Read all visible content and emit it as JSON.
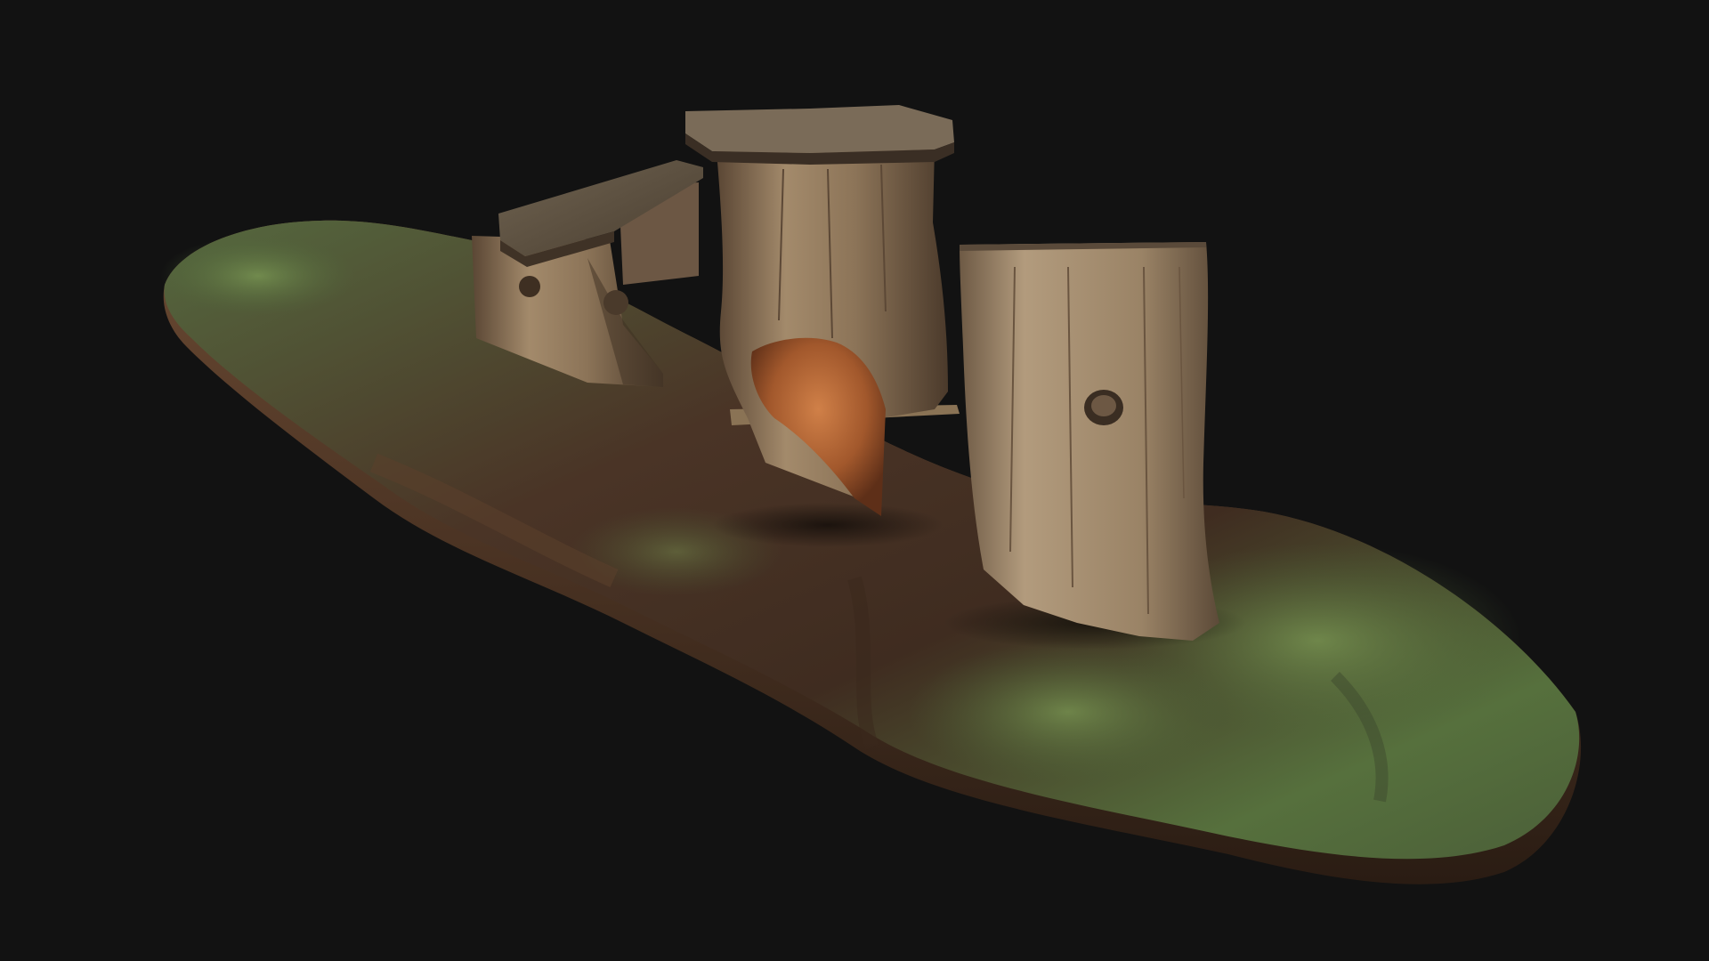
{
  "colors": {
    "background": "#121212",
    "soil_dark": "#2e2119",
    "soil": "#4a3426",
    "grass": "#4f6a3a",
    "grass_light": "#7c9a55",
    "wood_light": "#a68c6c",
    "wood": "#7d6549",
    "wood_dark": "#3d2f22",
    "rot": "#c0703c",
    "rot_dark": "#7a3e1e"
  },
  "objects": [
    {
      "name": "ground-mound",
      "desc_icon": "terrain-icon"
    },
    {
      "name": "bench-plank",
      "desc_icon": "bench-icon"
    },
    {
      "name": "table-stump",
      "desc_icon": "stump-icon"
    },
    {
      "name": "seat-stump",
      "desc_icon": "stump-icon"
    }
  ]
}
